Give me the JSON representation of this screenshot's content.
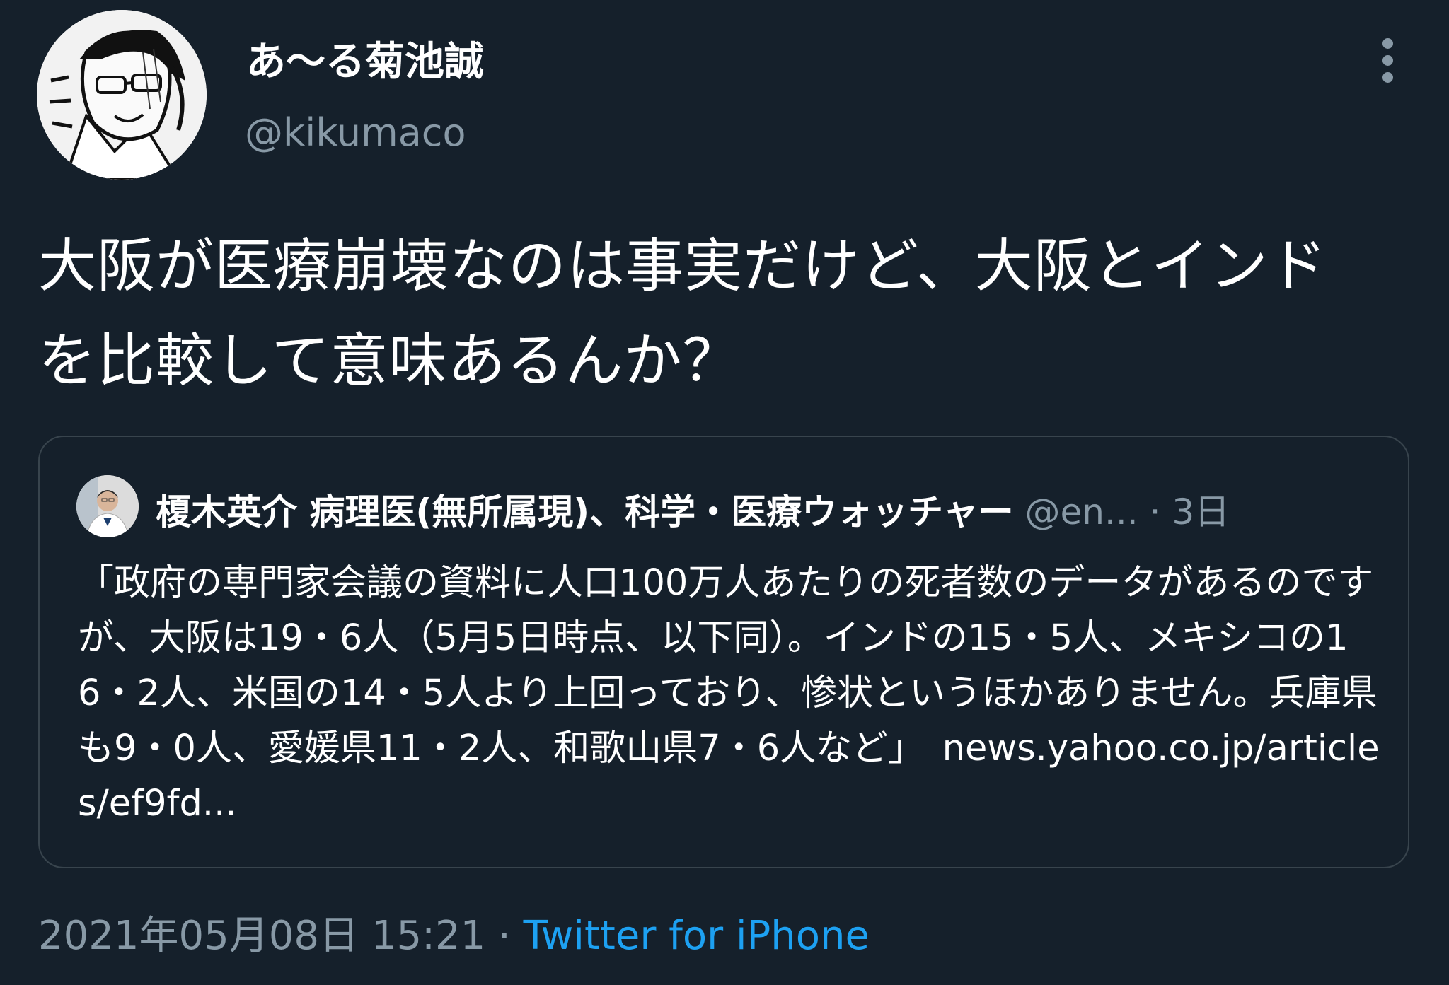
{
  "author": {
    "display_name": "あ〜る菊池誠",
    "handle": "@kikumaco"
  },
  "tweet": {
    "text_line1": "大阪が医療崩壊なのは事実だけど、大阪とインド",
    "text_line2": "を比較して意味あるんか？"
  },
  "quoted_tweet": {
    "display_name": "榎木英介 病理医(無所属現)、科学・医療ウォッチャー",
    "handle": "@en...",
    "separator": "·",
    "time": "3日",
    "text": "「政府の専門家会議の資料に人口100万人あたりの死者数のデータがあるのですが、大阪は19・6人（5月5日時点、以下同）。インドの15・5人、メキシコの16・2人、米国の14・5人より上回っており、惨状というほかありません。兵庫県も9・0人、愛媛県11・2人、和歌山県7・6人など」",
    "link": "news.yahoo.co.jp/articles/ef9fd..."
  },
  "meta": {
    "timestamp": "2021年05月08日 15:21",
    "separator": "·",
    "source": "Twitter for iPhone"
  },
  "icons": {
    "more": "more-vertical-icon",
    "avatar": "manga-style-avatar",
    "quote_avatar": "doctor-photo-avatar"
  },
  "colors": {
    "background": "#15202b",
    "secondary_text": "#8899a6",
    "accent": "#1da1f2",
    "border": "#38444d"
  }
}
